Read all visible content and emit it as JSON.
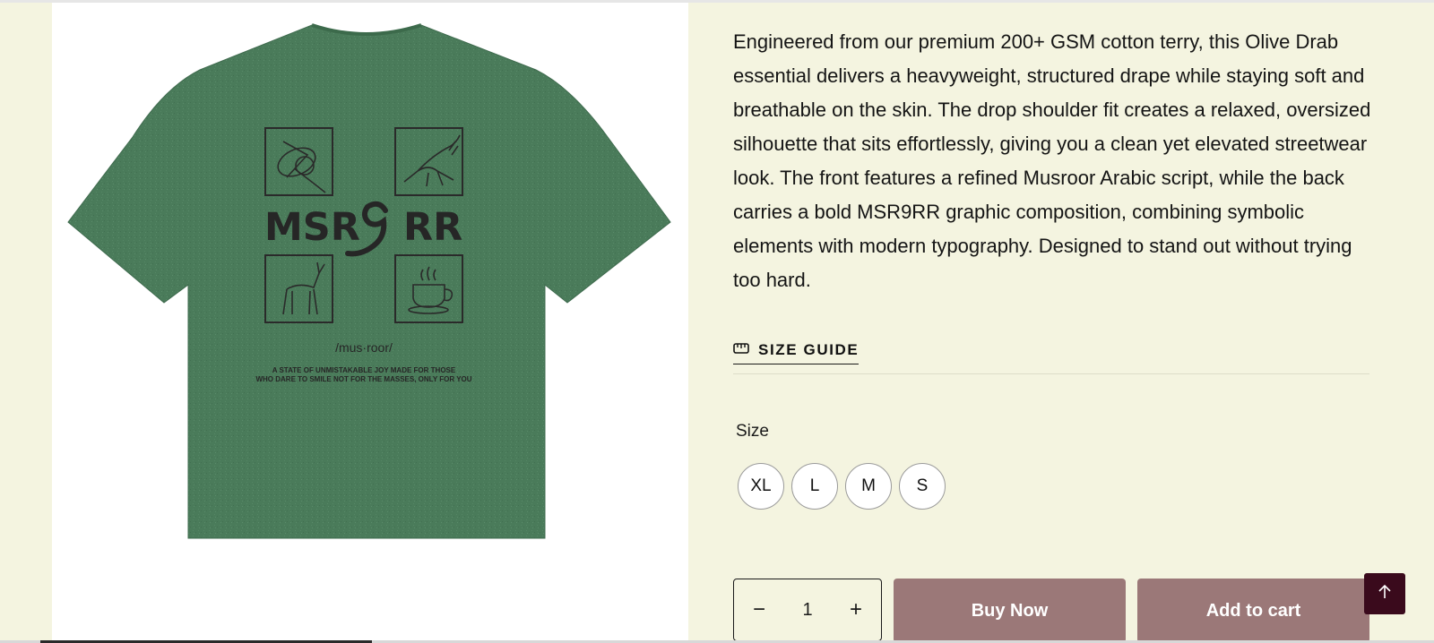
{
  "product": {
    "image_alt": "Olive Drab oversized t-shirt back view",
    "description": "Engineered from our premium 200+ GSM cotton terry, this Olive Drab essential delivers a heavyweight, structured drape while staying soft and breathable on the skin. The drop shoulder fit creates a relaxed, oversized silhouette that sits effortlessly, giving you a clean yet elevated streetwear look. The front features a refined Musroor Arabic script, while the back carries a bold MSR9RR graphic composition, combining symbolic elements with modern typography. Designed to stand out without trying too hard.",
    "shirt_print": {
      "logo_text_left": "MSR",
      "logo_text_right": "RR",
      "logo_glyph": "٩",
      "phonetic": "/mus·roor/",
      "tagline_line1": "A STATE OF UNMISTAKABLE JOY MADE FOR THOSE",
      "tagline_line2": "WHO DARE TO SMILE NOT FOR THE MASSES, ONLY FOR YOU",
      "icons": [
        "abstract-orbit-icon",
        "eagle-icon",
        "gazelle-icon",
        "coffee-cup-icon"
      ]
    }
  },
  "size_guide": {
    "label": "SIZE GUIDE",
    "icon": "ruler-icon"
  },
  "size_selector": {
    "label": "Size",
    "options": [
      "XL",
      "L",
      "M",
      "S"
    ]
  },
  "quantity": {
    "minus": "−",
    "value": "1",
    "plus": "+"
  },
  "buttons": {
    "buy_now": "Buy Now",
    "add_to_cart": "Add to cart"
  },
  "scroll_top": {
    "icon": "arrow-up-icon"
  },
  "colors": {
    "page_background": "#f4f4e0",
    "shirt": "#4a7b5a",
    "cta": "#9b7878",
    "scroll_top": "#3a0a1c"
  }
}
